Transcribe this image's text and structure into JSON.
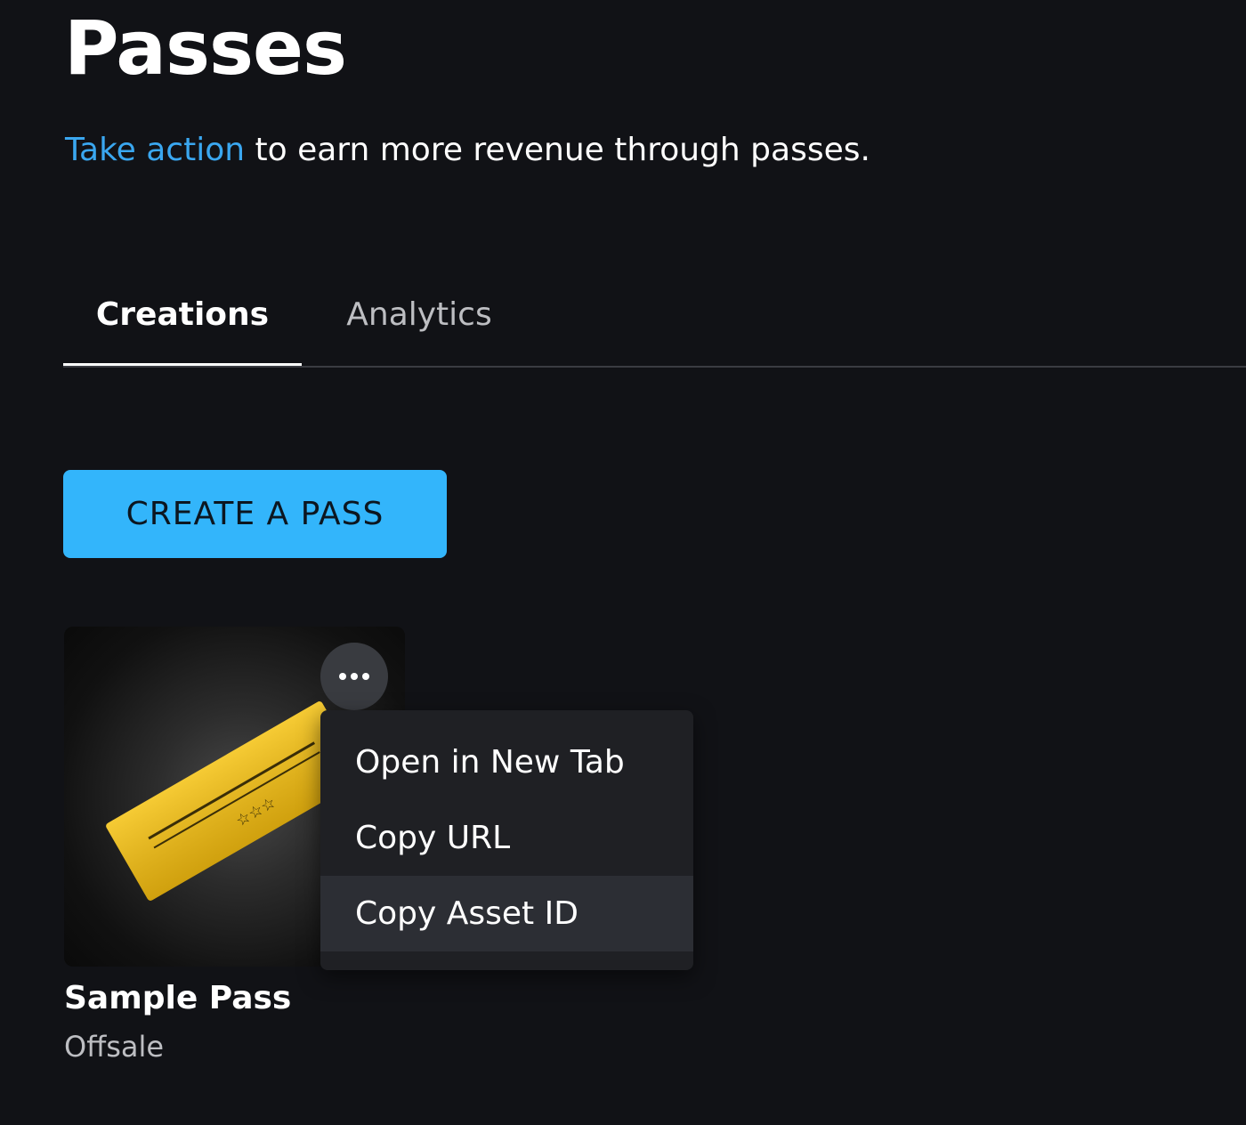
{
  "page": {
    "title": "Passes",
    "subtitle_link": "Take action",
    "subtitle_rest": " to earn more revenue through passes."
  },
  "tabs": [
    {
      "label": "Creations",
      "active": true
    },
    {
      "label": "Analytics",
      "active": false
    }
  ],
  "create_button_label": "CREATE A PASS",
  "pass_card": {
    "name": "Sample Pass",
    "status": "Offsale",
    "thumbnail_icon": "golden-ticket-icon",
    "more_icon": "more-horizontal-icon"
  },
  "context_menu": {
    "items": [
      {
        "label": "Open in New Tab"
      },
      {
        "label": "Copy URL"
      },
      {
        "label": "Copy Asset ID",
        "hovered": true
      }
    ]
  },
  "colors": {
    "background": "#111216",
    "accent_link": "#3aa7f0",
    "primary_button": "#33b5fb",
    "ticket_gold": "#f2c21b",
    "menu_background": "#1f2024"
  }
}
